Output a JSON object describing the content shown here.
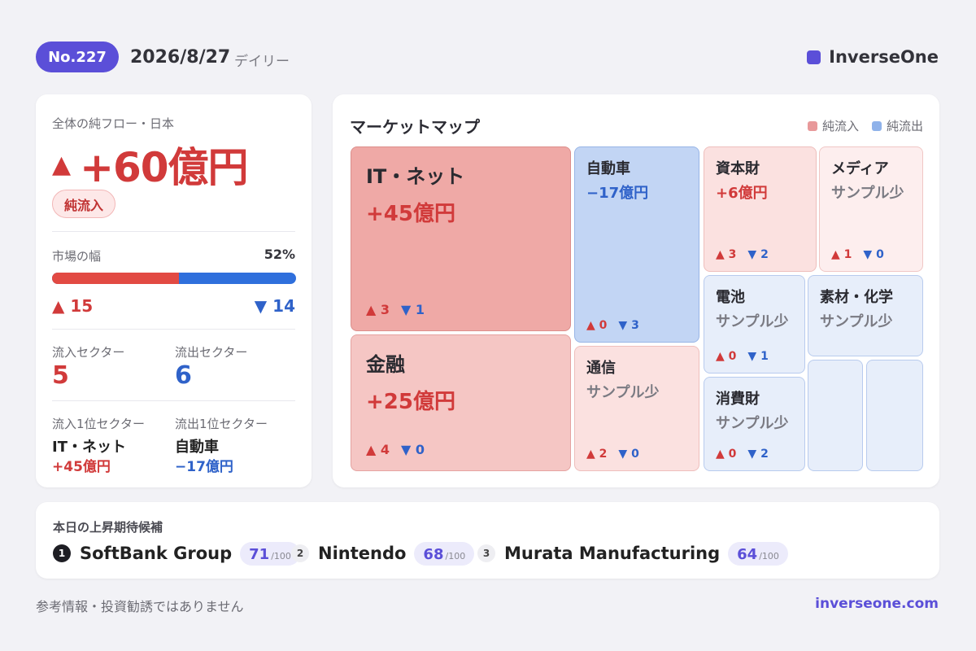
{
  "header": {
    "issue": "No.227",
    "date": "2026/8/27",
    "kind": "デイリー",
    "brand": "InverseOne",
    "accent": "#5b4fd8"
  },
  "summary": {
    "label": "全体の純フロー・日本",
    "net_flow": "+60億円",
    "direction_icon": "▲",
    "status": "純流入",
    "breadth_label": "市場の幅",
    "breadth_pct": "52%",
    "breadth_fraction": 0.52,
    "advancers": "15",
    "decliners": "14",
    "inflow_sectors_label": "流入セクター",
    "inflow_sectors": "5",
    "outflow_sectors_label": "流出セクター",
    "outflow_sectors": "6",
    "top_inflow_label": "流入1位セクター",
    "top_inflow_name": "IT・ネット",
    "top_inflow_value": "+45億円",
    "top_outflow_label": "流出1位セクター",
    "top_outflow_name": "自動車",
    "top_outflow_value": "−17億円"
  },
  "map": {
    "title": "マーケットマップ",
    "legend_in": "純流入",
    "legend_out": "純流出",
    "up_icon": "▲",
    "down_icon": "▼",
    "colors": {
      "inflow": "#e8999a",
      "outflow": "#8fb2ea"
    },
    "tiles": {
      "it": {
        "name": "IT・ネット",
        "value": "+45億円",
        "up": "3",
        "down": "1"
      },
      "fin": {
        "name": "金融",
        "value": "+25億円",
        "up": "4",
        "down": "0"
      },
      "auto": {
        "name": "自動車",
        "value": "−17億円",
        "up": "0",
        "down": "3"
      },
      "tel": {
        "name": "通信",
        "value": "サンプル少",
        "up": "2",
        "down": "0"
      },
      "cap": {
        "name": "資本財",
        "value": "+6億円",
        "up": "3",
        "down": "2"
      },
      "media": {
        "name": "メディア",
        "value": "サンプル少",
        "up": "1",
        "down": "0"
      },
      "bat": {
        "name": "電池",
        "value": "サンプル少",
        "up": "0",
        "down": "1"
      },
      "mat": {
        "name": "素材・化学",
        "value": "サンプル少"
      },
      "cons": {
        "name": "消費財",
        "value": "サンプル少",
        "up": "0",
        "down": "2"
      }
    }
  },
  "candidates": {
    "title": "本日の上昇期待候補",
    "max": "/100",
    "items": [
      {
        "rank": "1",
        "name": "SoftBank Group",
        "score": "71"
      },
      {
        "rank": "2",
        "name": "Nintendo",
        "score": "68"
      },
      {
        "rank": "3",
        "name": "Murata Manufacturing",
        "score": "64"
      }
    ]
  },
  "footer": {
    "disclaimer": "参考情報・投資勧誘ではありません",
    "site": "inverseone.com"
  }
}
